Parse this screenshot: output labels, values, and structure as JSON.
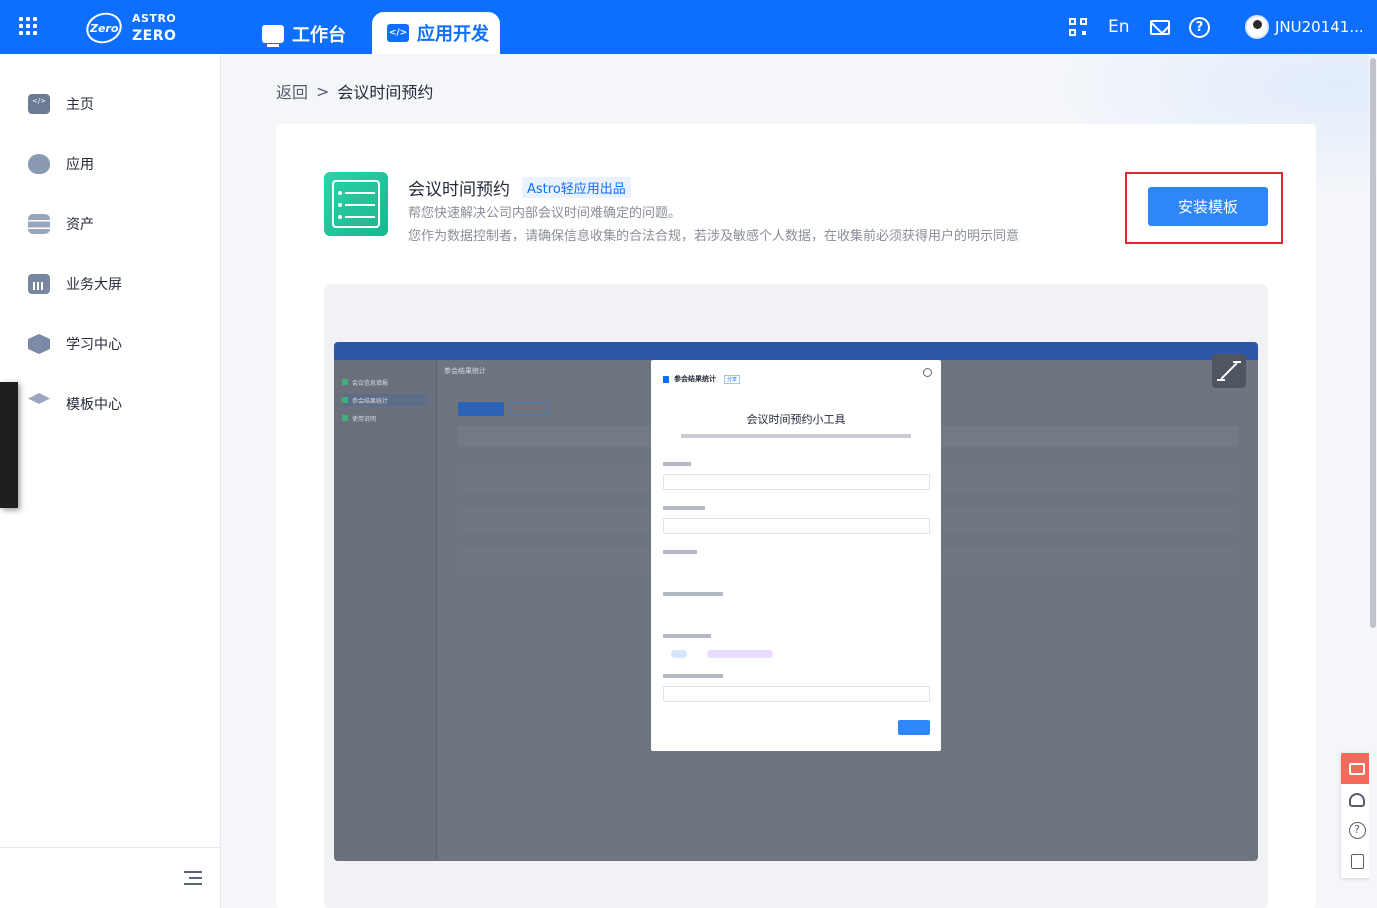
{
  "topbar": {
    "logo_top": "ASTRO",
    "logo_bottom": "ZERO",
    "logo_badge": "Zero",
    "tabs": [
      {
        "label": "工作台",
        "icon": "monitor-icon"
      },
      {
        "label": "应用开发",
        "icon": "code-icon"
      }
    ],
    "lang": "En",
    "user_name": "JNU20141..."
  },
  "sidebar": {
    "items": [
      {
        "label": "主页",
        "icon": "home-code-icon"
      },
      {
        "label": "应用",
        "icon": "app-icon"
      },
      {
        "label": "资产",
        "icon": "database-icon"
      },
      {
        "label": "业务大屏",
        "icon": "bar-chart-icon"
      },
      {
        "label": "学习中心",
        "icon": "learning-icon"
      },
      {
        "label": "模板中心",
        "icon": "template-layers-icon"
      }
    ]
  },
  "breadcrumb": {
    "back": "返回",
    "separator": ">",
    "current": "会议时间预约"
  },
  "template": {
    "title": "会议时间预约",
    "badge": "Astro轻应用出品",
    "description": "帮您快速解决公司内部会议时间难确定的问题。",
    "note": "您作为数据控制者，请确保信息收集的合法合规，若涉及敏感个人数据，在收集前必须获得用户的明示同意",
    "install_label": "安装模板"
  },
  "preview": {
    "header_title": "参会结果统计",
    "sidebar_items": [
      "会议信息填报",
      "参会结果统计",
      "使用说明"
    ],
    "modal_header": "参会结果统计",
    "modal_tag": "分享",
    "modal_title": "会议时间预约小工具"
  },
  "colors": {
    "brand": "#0e6fff",
    "install_button": "#2f86f6",
    "highlight_border": "#e0262f",
    "chat_button": "#f26b5b"
  }
}
